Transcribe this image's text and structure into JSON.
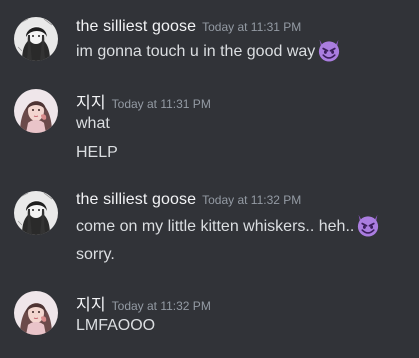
{
  "messages": [
    {
      "author": "the silliest goose",
      "timestamp": "Today at 11:31 PM",
      "lines": [
        {
          "text": "im gonna touch u in the good way",
          "emoji": "smiling-imp-emoji"
        }
      ]
    },
    {
      "author": "지지",
      "timestamp": "Today at 11:31 PM",
      "lines": [
        {
          "text": "what"
        },
        {
          "text": "HELP"
        }
      ]
    },
    {
      "author": "the silliest goose",
      "timestamp": "Today at 11:32 PM",
      "lines": [
        {
          "text": "come on my little kitten whiskers.. heh..",
          "emoji": "smiling-imp-emoji"
        },
        {
          "text": "sorry."
        }
      ]
    },
    {
      "author": "지지",
      "timestamp": "Today at 11:32 PM",
      "lines": [
        {
          "text": "LMFAOOO"
        }
      ]
    }
  ],
  "colors": {
    "background": "#313338",
    "username": "#f2f3f5",
    "timestamp": "#949ba4",
    "message_text": "#dbdee1",
    "emoji_purple": "#8e5cc4"
  }
}
